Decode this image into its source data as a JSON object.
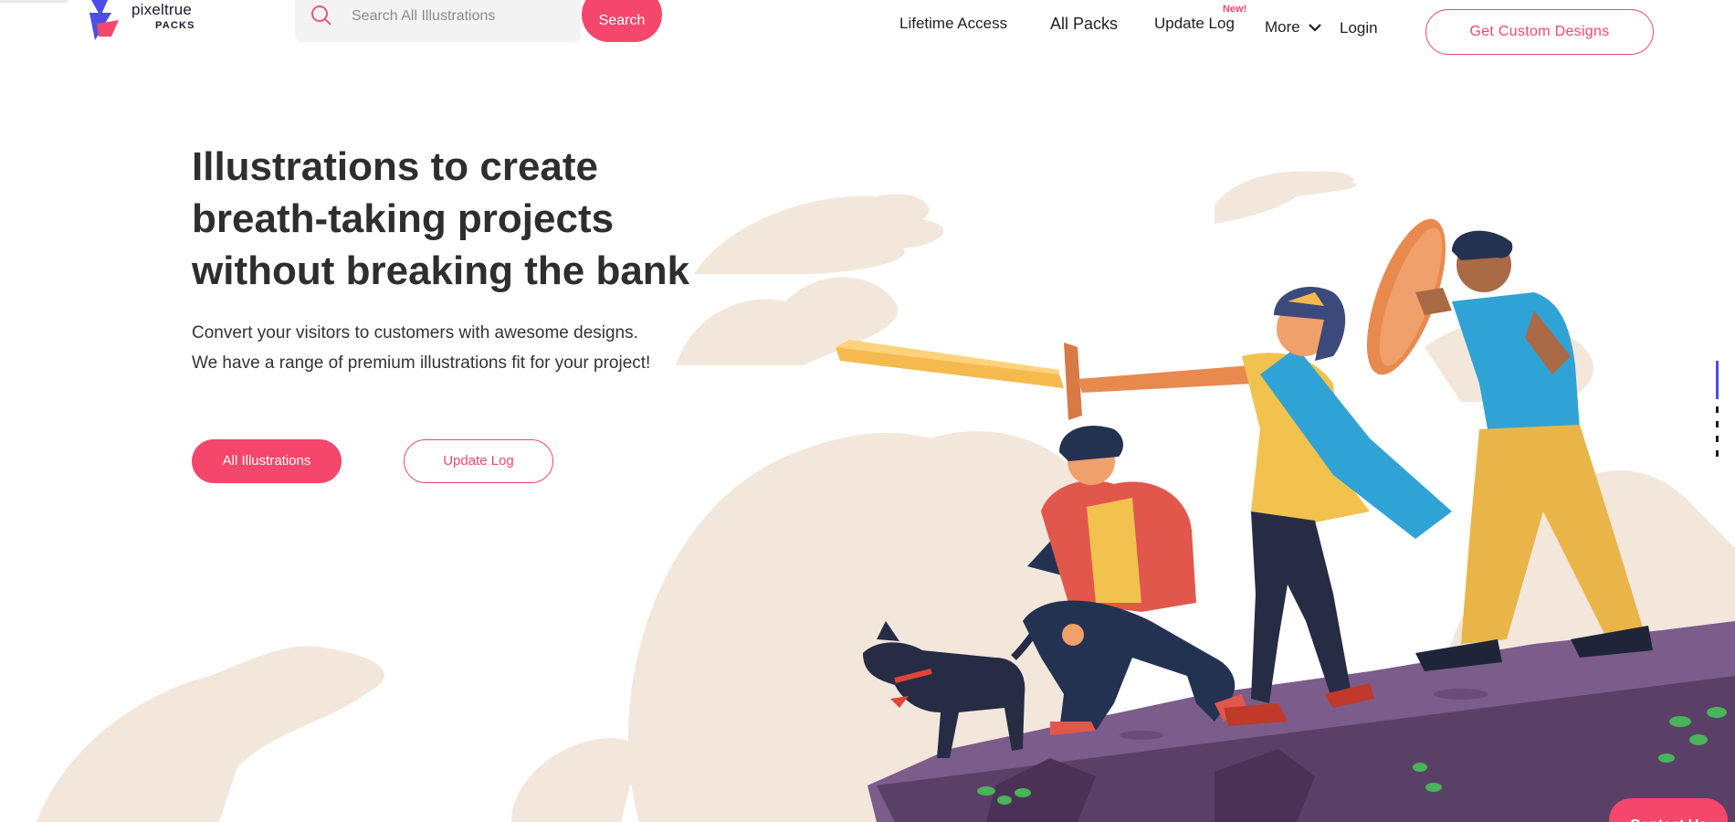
{
  "header": {
    "logo": {
      "name": "pixeltrue",
      "sub": "PACKS"
    },
    "search": {
      "placeholder": "Search All Illustrations",
      "value": "",
      "button_label": "Search"
    },
    "nav": {
      "lifetime_access": "Lifetime Access",
      "all_packs": "All Packs",
      "update_log": "Update Log",
      "update_log_badge": "New!",
      "more": "More",
      "login": "Login"
    },
    "cta_label": "Get Custom Designs"
  },
  "hero": {
    "title_lines": [
      "Illustrations to create",
      "breath-taking projects",
      "without breaking the bank"
    ],
    "subtitle_lines": [
      "Convert your visitors to customers with awesome designs.",
      "We have a range of premium illustrations fit for your project!"
    ],
    "primary_button": "All Illustrations",
    "secondary_button": "Update Log"
  },
  "floating": {
    "contact_label": "Contact Us"
  },
  "colors": {
    "accent": "#f5466b",
    "brand_blue": "#4b4ee8",
    "cloud": "#f3e7dc",
    "cliff": "#7c5c8a",
    "text": "#2e2e2e"
  },
  "icons": {
    "search": "search-icon",
    "more": "chevron-down-icon",
    "logo": "pixeltrue-logo-icon"
  }
}
